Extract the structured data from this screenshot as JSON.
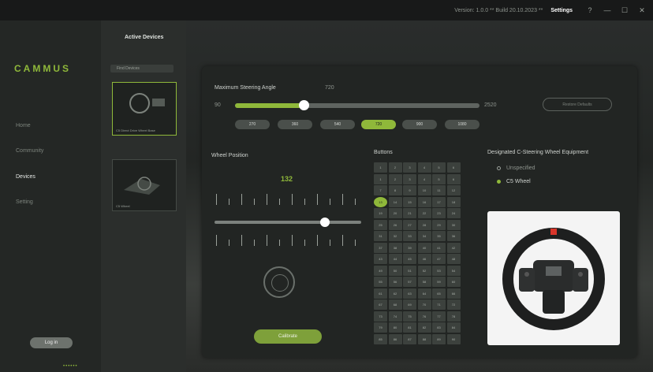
{
  "titlebar": {
    "info": "Version: 1.0.0 ** Build 20.10.2023 **",
    "settings": "Settings",
    "icons": [
      "help-icon",
      "minimize-icon",
      "maximize-icon",
      "close-icon"
    ]
  },
  "sidebar": {
    "logo": "CAMMUS",
    "items": [
      "Home",
      "Community",
      "Devices",
      "Setting"
    ],
    "active": "Devices",
    "login": "Log in",
    "status_dots": "••••••"
  },
  "devices": {
    "title": "Active Devices",
    "search": "Find Devices",
    "cards": [
      {
        "label": "C5 Direct Drive Wheel Base"
      },
      {
        "label": "C5 Wheel"
      }
    ]
  },
  "steering": {
    "label": "Maximum Steering Angle",
    "value": "720",
    "min": "90",
    "max": "2520",
    "fraction": 0.28,
    "presets": [
      "270",
      "360",
      "540",
      "720",
      "900",
      "1080"
    ],
    "active_preset": "720",
    "restore": "Restore Defaults"
  },
  "wheel_position": {
    "label": "Wheel Position",
    "value": "132",
    "fraction": 0.75,
    "calibrate": "Calibrate"
  },
  "buttons": {
    "label": "Buttons",
    "headers": [
      "1",
      "2",
      "3",
      "4",
      "5",
      "6"
    ],
    "highlight": "13",
    "cells": [
      "1",
      "2",
      "3",
      "4",
      "5",
      "6",
      "7",
      "8",
      "9",
      "10",
      "11",
      "12",
      "13",
      "14",
      "15",
      "16",
      "17",
      "18",
      "19",
      "20",
      "21",
      "22",
      "23",
      "24",
      "25",
      "26",
      "27",
      "28",
      "29",
      "30",
      "31",
      "32",
      "33",
      "34",
      "35",
      "36",
      "37",
      "38",
      "39",
      "40",
      "41",
      "42",
      "43",
      "44",
      "45",
      "46",
      "47",
      "48",
      "49",
      "50",
      "51",
      "52",
      "53",
      "54",
      "55",
      "56",
      "57",
      "58",
      "59",
      "60",
      "61",
      "62",
      "63",
      "64",
      "65",
      "66",
      "67",
      "68",
      "69",
      "70",
      "71",
      "72",
      "73",
      "74",
      "75",
      "76",
      "77",
      "78",
      "79",
      "80",
      "81",
      "82",
      "83",
      "84",
      "85",
      "86",
      "87",
      "88",
      "89",
      "90"
    ]
  },
  "equipment": {
    "label": "Designated C-Steering Wheel Equipment",
    "options": [
      "Unspecified",
      "C5 Wheel"
    ],
    "selected": "C5 Wheel"
  },
  "colors": {
    "accent": "#8fb83a",
    "panel": "#222523",
    "sidebar": "#242725"
  }
}
